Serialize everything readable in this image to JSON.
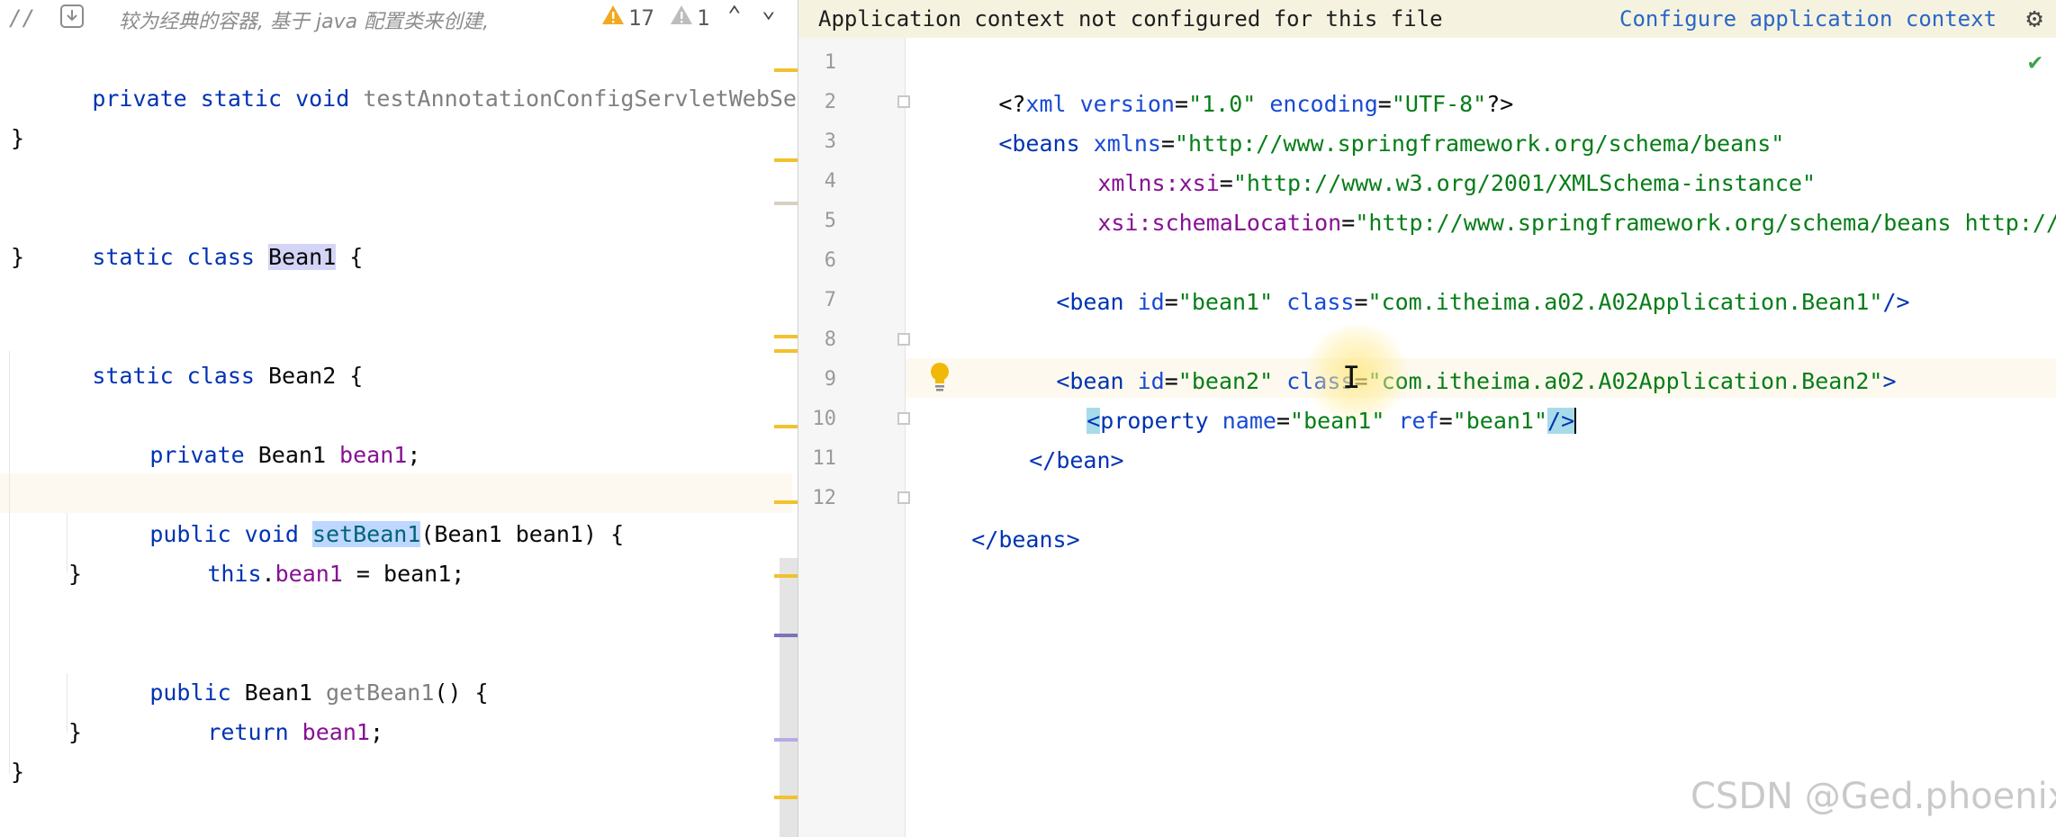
{
  "left_toolbar": {
    "comment": "//",
    "comment_text": "较为经典的容器, 基于 java 配置类来创建,",
    "warnings_count": "17",
    "weak_warnings_count": "1"
  },
  "java_code": {
    "l1": {
      "a": "private static void ",
      "b": "testAnnotationConfigServletWebServe"
    },
    "l3": "}",
    "l5": {
      "a": "static class ",
      "b": "Bean1",
      "c": " {"
    },
    "l6": "}",
    "l8": {
      "a": "static class ",
      "b": "Bean2 {"
    },
    "l10": {
      "a": "private ",
      "b": "Bean1 ",
      "c": "bean1",
      "d": ";"
    },
    "l12": {
      "a": "public void ",
      "b": "setBean1",
      "c": "(Bean1 bean1) {"
    },
    "l13": {
      "a": "this",
      "b": ".",
      "c": "bean1",
      "d": " = bean1;"
    },
    "l14": "}",
    "l16": {
      "a": "public ",
      "b": "Bean1 ",
      "c": "getBean1",
      "d": "() {"
    },
    "l17": {
      "a": "return ",
      "b": "bean1",
      "c": ";"
    },
    "l18": "}",
    "l19": "}"
  },
  "banner": {
    "message": "Application context not configured for this file",
    "action": "Configure application context"
  },
  "xml_code": {
    "line_numbers": [
      "1",
      "2",
      "3",
      "4",
      "5",
      "6",
      "7",
      "8",
      "9",
      "10",
      "11",
      "12"
    ],
    "l1": {
      "a": "<?",
      "b": "xml version",
      "c": "=",
      "d": "\"1.0\"",
      "e": " encoding",
      "f": "=",
      "g": "\"UTF-8\"",
      "h": "?>"
    },
    "l2": {
      "a": "<beans ",
      "b": "xmlns",
      "c": "=",
      "d": "\"http://www.springframework.org/schema/beans\""
    },
    "l3": {
      "a": "xmlns:xsi",
      "b": "=",
      "c": "\"http://www.w3.org/2001/XMLSchema-instance\""
    },
    "l4": {
      "a": "xsi:schemaLocation",
      "b": "=",
      "c": "\"http://www.springframework.org/schema/beans http://ww"
    },
    "l6": {
      "a": "<bean ",
      "b": "id",
      "c": "=",
      "d": "\"bean1\"",
      "e": " class",
      "f": "=",
      "g": "\"com.itheima.a02.A02Application.Bean1\"",
      "h": "/>"
    },
    "l8": {
      "a": "<bean ",
      "b": "id",
      "c": "=",
      "d": "\"bean2\"",
      "e": " class",
      "f": "=",
      "g": "\"com.itheima.a02.A02Application.Bean2\"",
      "h": ">"
    },
    "l9": {
      "a": "<",
      "b": "property ",
      "c": "name",
      "d": "=",
      "e": "\"bean1\"",
      "f": " ref",
      "g": "=",
      "h": "\"bean1\"",
      "i": "/>"
    },
    "l10": "</bean>",
    "l12": "</beans>"
  },
  "watermark": "CSDN @Ged.phoenix",
  "colors": {
    "keyword": "#0033b3",
    "field": "#871094",
    "string": "#067d17",
    "banner_bg": "#f5f3e0",
    "link": "#2a66c6",
    "warning": "#f2c12e"
  },
  "icons": [
    "comment-toggle-icon",
    "download-icon",
    "warning-icon",
    "weak-warning-icon",
    "chevron-up-icon",
    "chevron-down-icon",
    "gear-icon",
    "check-icon",
    "lightbulb-icon",
    "text-cursor-icon"
  ]
}
